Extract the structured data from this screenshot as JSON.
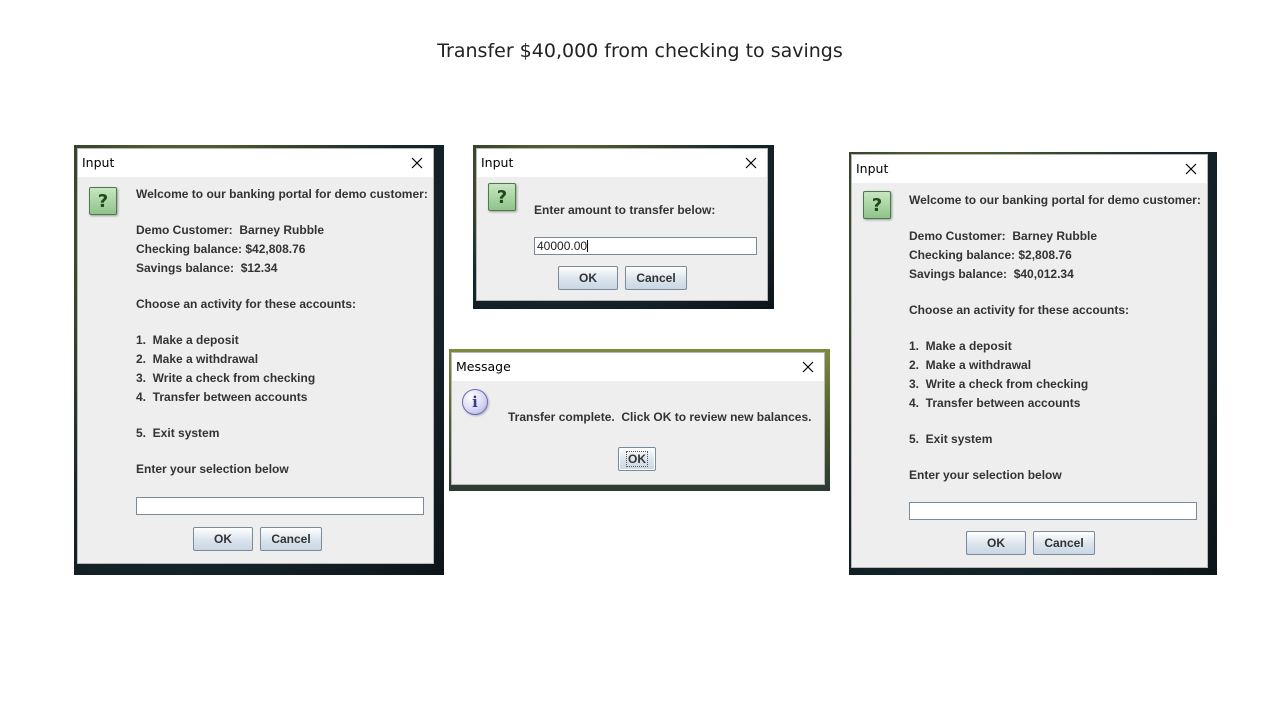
{
  "slide": {
    "title": "Transfer $40,000 from checking to savings"
  },
  "dialog_before": {
    "window_title": "Input",
    "lines": [
      "Welcome to our banking portal for demo customer:",
      "Demo Customer:  Barney Rubble",
      "Checking balance: $42,808.76",
      "Savings balance:  $12.34",
      "Choose an activity for these accounts:",
      "1.  Make a deposit",
      "2.  Make a withdrawal",
      "3.  Write a check from checking",
      "4.  Transfer between accounts",
      "5.  Exit system",
      "Enter your selection below"
    ],
    "input_value": "",
    "ok_label": "OK",
    "cancel_label": "Cancel",
    "icon": "question-icon"
  },
  "dialog_amount": {
    "window_title": "Input",
    "prompt": "Enter amount to transfer below:",
    "input_value": "40000.00",
    "ok_label": "OK",
    "cancel_label": "Cancel",
    "icon": "question-icon"
  },
  "dialog_message": {
    "window_title": "Message",
    "message": "Transfer complete.  Click OK to review new balances.",
    "ok_label": "OK",
    "icon": "information-icon"
  },
  "dialog_after": {
    "window_title": "Input",
    "lines": [
      "Welcome to our banking portal for demo customer:",
      "Demo Customer:  Barney Rubble",
      "Checking balance: $2,808.76",
      "Savings balance:  $40,012.34",
      "Choose an activity for these accounts:",
      "1.  Make a deposit",
      "2.  Make a withdrawal",
      "3.  Write a check from checking",
      "4.  Transfer between accounts",
      "5.  Exit system",
      "Enter your selection below"
    ],
    "input_value": "",
    "ok_label": "OK",
    "cancel_label": "Cancel",
    "icon": "question-icon"
  },
  "glyphs": {
    "question": "?",
    "info": "i",
    "close": "✕"
  }
}
